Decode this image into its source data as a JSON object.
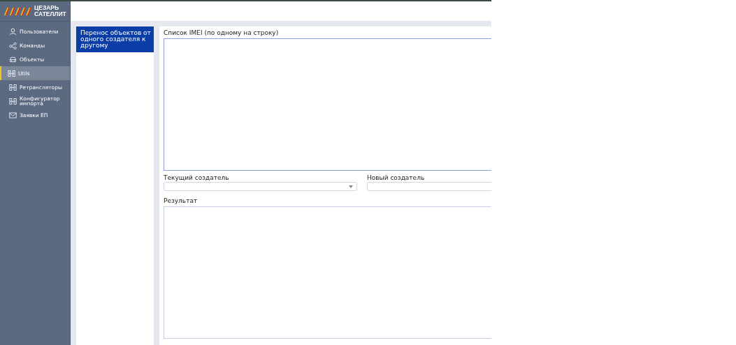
{
  "logo": {
    "line_1": "ЦЕЗАРЬ",
    "line_2": "САТЕЛЛИТ"
  },
  "sidebar": {
    "items": [
      {
        "label": "Пользователи",
        "kind": "user",
        "selected": false
      },
      {
        "label": "Команды",
        "kind": "share",
        "selected": false
      },
      {
        "label": "Объекты",
        "kind": "car",
        "selected": false
      },
      {
        "label": "Utils",
        "kind": "device",
        "selected": true
      },
      {
        "label": "Ретрансляторы",
        "kind": "device",
        "selected": false
      },
      {
        "label": "Конфигуратор импорта",
        "kind": "device",
        "selected": false
      },
      {
        "label": "Заявки ЕП",
        "kind": "mail",
        "selected": false
      }
    ]
  },
  "tools": [
    {
      "label": "Перенос объектов от одного создателя к другому",
      "selected": true
    }
  ],
  "form": {
    "imei_label": "Список IMEI (по одному на строку)",
    "current_creator_label": "Текущий создатель",
    "new_creator_label": "Новый создатель",
    "result_label": "Результат"
  }
}
